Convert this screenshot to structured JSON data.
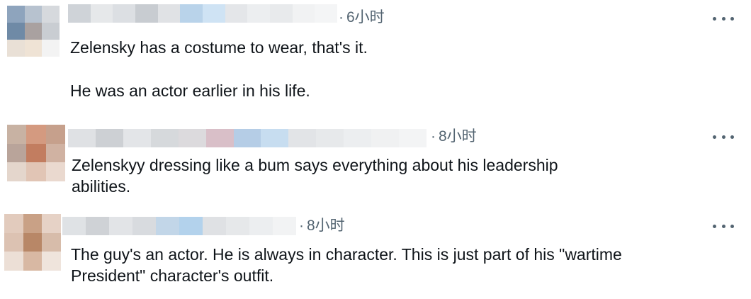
{
  "comments": [
    {
      "time": "6小时",
      "lines": [
        "Zelensky has a costume to wear, that's it.",
        "He was an actor earlier in his life."
      ],
      "avatar_colors": [
        "#8ea4bd",
        "#b7c2cf",
        "#d6d9dd",
        "#6f8aa6",
        "#a9a1a0",
        "#c9cdd2",
        "#e9e0d6",
        "#efe3d5",
        "#f3f3f3"
      ],
      "name_colors": [
        "#cfd3d8",
        "#e6e8ea",
        "#dcdfe3",
        "#c8ccd1",
        "#e0e2e5",
        "#b9d3ea",
        "#cfe3f4",
        "#e4e6e9",
        "#eceef0",
        "#e8eaec",
        "#f1f2f3",
        "#f4f5f6"
      ]
    },
    {
      "time": "8小时",
      "lines": [
        "Zelenskyy dressing like a bum says everything about his leadership",
        "abilities."
      ],
      "avatar_colors": [
        "#c8b2a3",
        "#d49a80",
        "#c6a08c",
        "#b9a49a",
        "#c27d60",
        "#d0b2a2",
        "#e4d6cc",
        "#e1c5b5",
        "#ead9cf"
      ],
      "name_colors": [
        "#dfe1e4",
        "#cdd0d4",
        "#e3e5e8",
        "#d6d9dc",
        "#dcdadd",
        "#d9bfc8",
        "#b5cde6",
        "#c7ddf0",
        "#e2e4e7",
        "#e7e9eb",
        "#eceef0",
        "#f0f1f2",
        "#f3f4f5"
      ]
    },
    {
      "time": "8小时",
      "lines": [
        "The guy's an actor. He is always in character. This is just part of his \"wartime",
        "President\" character's outfit."
      ],
      "avatar_colors": [
        "#e2cbbd",
        "#c9a186",
        "#e6d2c6",
        "#dcc2b2",
        "#b88767",
        "#d7bcaa",
        "#ecdfd6",
        "#d8b8a3",
        "#efe4dc"
      ],
      "name_colors": [
        "#dfe2e5",
        "#cfd2d6",
        "#e2e4e7",
        "#d8dbdf",
        "#c2d6e8",
        "#b3d2ec",
        "#dfe1e4",
        "#e6e8ea",
        "#eceef0",
        "#f2f3f4"
      ]
    }
  ],
  "more_icon": "more-horizontal-icon"
}
